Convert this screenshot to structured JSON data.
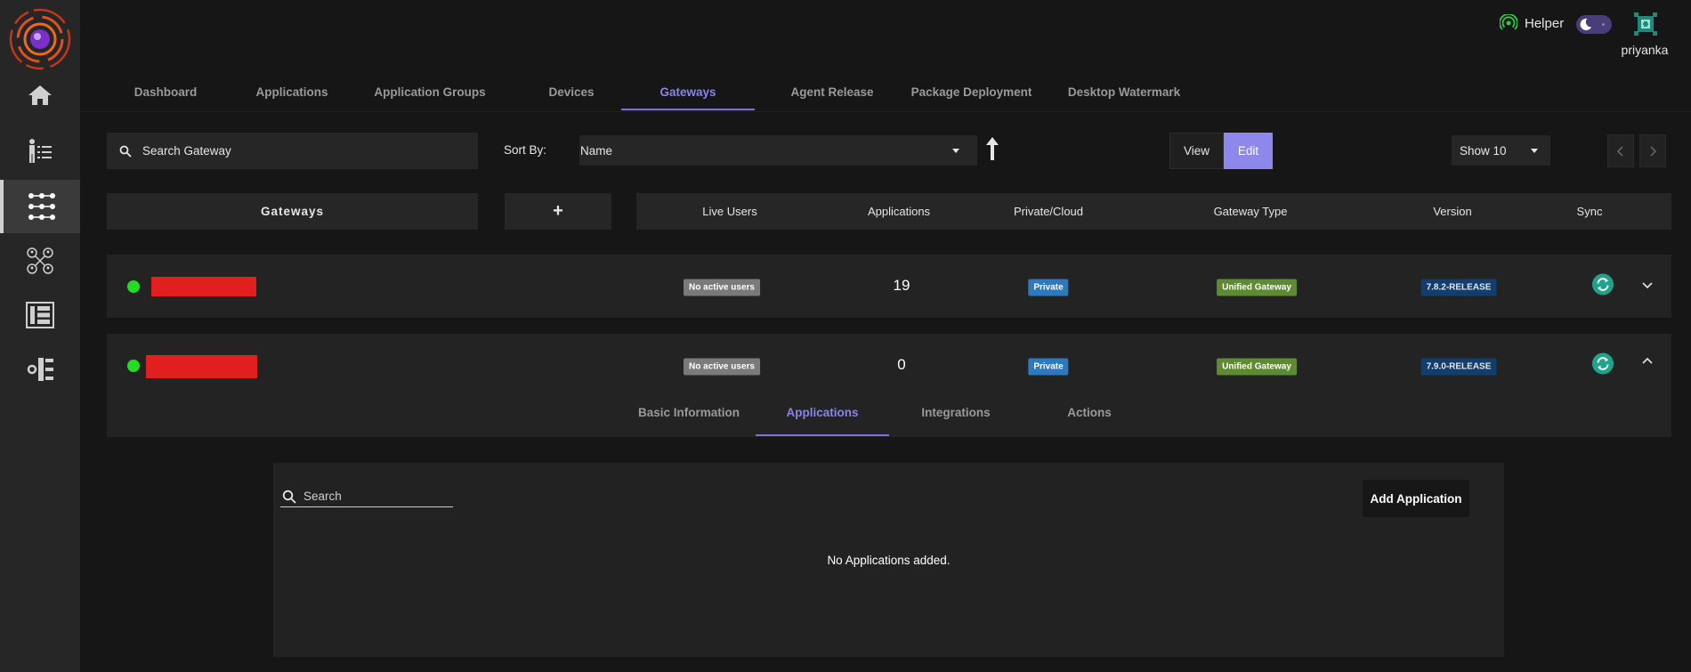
{
  "user": {
    "helper_label": "Helper",
    "username": "priyanka"
  },
  "sidebar": {
    "items": [
      {
        "icon": "home-icon"
      },
      {
        "icon": "user-list-icon"
      },
      {
        "icon": "grid-dots-icon"
      },
      {
        "icon": "network-users-icon"
      },
      {
        "icon": "list-panel-icon"
      },
      {
        "icon": "settings-tree-icon"
      }
    ]
  },
  "tabs": [
    "Dashboard",
    "Applications",
    "Application Groups",
    "Devices",
    "Gateways",
    "Agent Release",
    "Package Deployment",
    "Desktop Watermark"
  ],
  "active_tab": "Gateways",
  "toolbar": {
    "search_placeholder": "Search Gateway",
    "sort_label": "Sort By:",
    "sort_value": "Name",
    "view_label": "View",
    "edit_label": "Edit",
    "show_value": "Show 10"
  },
  "table": {
    "gateways_header": "Gateways",
    "add_label": "+",
    "columns": [
      "Live Users",
      "Applications",
      "Private/Cloud",
      "Gateway Type",
      "Version",
      "Sync"
    ],
    "rows": [
      {
        "status_color": "#22dd22",
        "live_users": "No active users",
        "applications": "19",
        "private_cloud": "Private",
        "gateway_type": "Unified Gateway",
        "version": "7.8.2-RELEASE",
        "expanded": false
      },
      {
        "status_color": "#22dd22",
        "live_users": "No active users",
        "applications": "0",
        "private_cloud": "Private",
        "gateway_type": "Unified Gateway",
        "version": "7.9.0-RELEASE",
        "expanded": true
      }
    ]
  },
  "detail": {
    "tabs": [
      "Basic Information",
      "Applications",
      "Integrations",
      "Actions"
    ],
    "active_tab": "Applications",
    "search_placeholder": "Search",
    "add_button": "Add Application",
    "empty_message": "No Applications added."
  },
  "colors": {
    "accent": "#8b83e8",
    "status_online": "#22dd22",
    "redacted": "#e21f1f"
  }
}
